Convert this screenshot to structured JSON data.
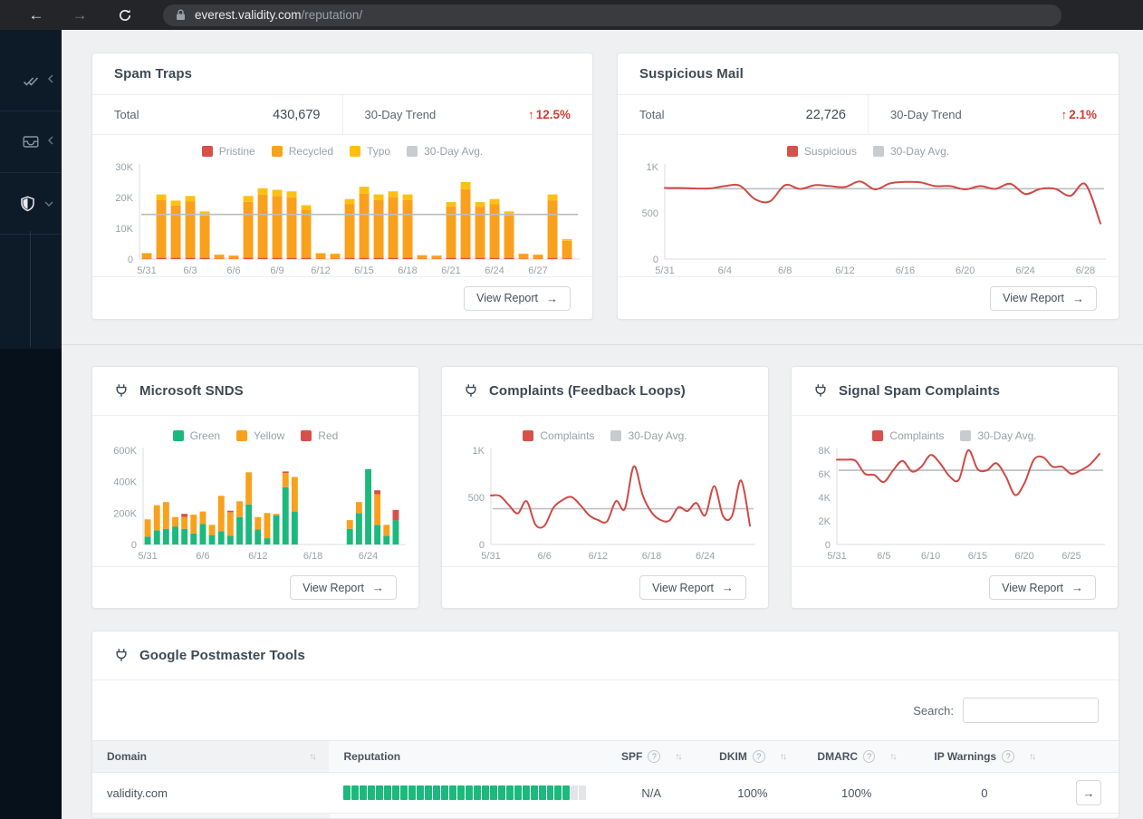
{
  "browser": {
    "url_host": "everest.validity.com",
    "url_path": "/reputation/"
  },
  "icons": {
    "arrow_up": "↑",
    "arrow_right": "→",
    "sort": "↑↓",
    "help": "?",
    "back": "←",
    "forward": "→"
  },
  "colors": {
    "red": "#d8504a",
    "orange": "#f9a11c",
    "yellow": "#fdc012",
    "green": "#1cb97d",
    "gray_avg": "#c9cccf",
    "trend_red": "#d63a32",
    "segment_empty": "#e3e5e7"
  },
  "cards": {
    "spam_traps": {
      "title": "Spam Traps",
      "total_label": "Total",
      "total_value": "430,679",
      "trend_label": "30-Day Trend",
      "trend_value": "12.5%",
      "view_report": "View Report"
    },
    "suspicious": {
      "title": "Suspicious Mail",
      "total_label": "Total",
      "total_value": "22,726",
      "trend_label": "30-Day Trend",
      "trend_value": "2.1%",
      "view_report": "View Report"
    },
    "snds": {
      "title": "Microsoft SNDS",
      "view_report": "View Report"
    },
    "complaints": {
      "title": "Complaints (Feedback Loops)",
      "view_report": "View Report"
    },
    "signal": {
      "title": "Signal Spam Complaints",
      "view_report": "View Report"
    },
    "postmaster": {
      "title": "Google Postmaster Tools",
      "search_label": "Search:"
    }
  },
  "charts": {
    "spam_traps": {
      "type": "stacked-bar",
      "ymax": 30000,
      "avg": 14500,
      "yticks": [
        {
          "v": 0,
          "label": "0"
        },
        {
          "v": 10000,
          "label": "10K"
        },
        {
          "v": 20000,
          "label": "20K"
        },
        {
          "v": 30000,
          "label": "30K"
        }
      ],
      "xticks": [
        {
          "i": 0,
          "label": "5/31"
        },
        {
          "i": 3,
          "label": "6/3"
        },
        {
          "i": 6,
          "label": "6/6"
        },
        {
          "i": 9,
          "label": "6/9"
        },
        {
          "i": 12,
          "label": "6/12"
        },
        {
          "i": 15,
          "label": "6/15"
        },
        {
          "i": 18,
          "label": "6/18"
        },
        {
          "i": 21,
          "label": "6/21"
        },
        {
          "i": 24,
          "label": "6/24"
        },
        {
          "i": 27,
          "label": "6/27"
        }
      ],
      "legend": [
        {
          "label": "Pristine",
          "color": "#d8504a"
        },
        {
          "label": "Recycled",
          "color": "#f9a11c"
        },
        {
          "label": "Typo",
          "color": "#fdc012"
        },
        {
          "label": "30-Day Avg.",
          "color": "#c9cccf"
        }
      ],
      "series": [
        {
          "name": "Pristine",
          "color": "#d8504a",
          "values": [
            120,
            400,
            400,
            400,
            400,
            120,
            120,
            400,
            400,
            400,
            400,
            400,
            120,
            120,
            400,
            400,
            400,
            400,
            400,
            120,
            120,
            400,
            400,
            400,
            400,
            400,
            120,
            120,
            400,
            250
          ]
        },
        {
          "name": "Recycled",
          "color": "#f9a11c",
          "values": [
            1730,
            18800,
            17000,
            18400,
            13800,
            1230,
            960,
            18200,
            20500,
            20100,
            19700,
            15600,
            1700,
            1520,
            17400,
            20900,
            18800,
            19600,
            18800,
            1050,
            960,
            16500,
            22300,
            16500,
            17400,
            13800,
            1520,
            1240,
            18700,
            5700
          ]
        },
        {
          "name": "Typo",
          "color": "#fdc012",
          "values": [
            150,
            1800,
            1600,
            1700,
            1300,
            150,
            120,
            1900,
            2100,
            2000,
            1900,
            1500,
            180,
            160,
            1700,
            2200,
            1800,
            2000,
            1800,
            130,
            120,
            1600,
            2300,
            1600,
            1700,
            1300,
            160,
            140,
            1900,
            550
          ]
        }
      ]
    },
    "suspicious": {
      "type": "line",
      "ymax": 1000,
      "avg": 762,
      "yticks": [
        {
          "v": 0,
          "label": "0"
        },
        {
          "v": 500,
          "label": "500"
        },
        {
          "v": 1000,
          "label": "1K"
        }
      ],
      "xticks": [
        {
          "i": 0,
          "label": "5/31"
        },
        {
          "i": 4,
          "label": "6/4"
        },
        {
          "i": 8,
          "label": "6/8"
        },
        {
          "i": 12,
          "label": "6/12"
        },
        {
          "i": 16,
          "label": "6/16"
        },
        {
          "i": 20,
          "label": "6/20"
        },
        {
          "i": 24,
          "label": "6/24"
        },
        {
          "i": 28,
          "label": "6/28"
        }
      ],
      "legend": [
        {
          "label": "Suspicious",
          "color": "#d8504a"
        },
        {
          "label": "30-Day Avg.",
          "color": "#c9cccf"
        }
      ],
      "series": [
        {
          "name": "Suspicious",
          "color": "#cf4a45",
          "values": [
            770,
            770,
            765,
            765,
            790,
            795,
            650,
            625,
            800,
            760,
            800,
            790,
            780,
            840,
            755,
            820,
            835,
            830,
            790,
            790,
            755,
            790,
            760,
            815,
            705,
            760,
            760,
            685,
            810,
            385
          ]
        }
      ]
    },
    "snds": {
      "type": "stacked-bar",
      "ymax": 600,
      "avg": null,
      "yticks": [
        {
          "v": 0,
          "label": "0"
        },
        {
          "v": 200,
          "label": "200K"
        },
        {
          "v": 400,
          "label": "400K"
        },
        {
          "v": 600,
          "label": "600K"
        }
      ],
      "xticks": [
        {
          "i": 0,
          "label": "5/31"
        },
        {
          "i": 6,
          "label": "6/6"
        },
        {
          "i": 12,
          "label": "6/12"
        },
        {
          "i": 18,
          "label": "6/18"
        },
        {
          "i": 24,
          "label": "6/24"
        }
      ],
      "legend": [
        {
          "label": "Green",
          "color": "#1cb97d"
        },
        {
          "label": "Yellow",
          "color": "#f9a11c"
        },
        {
          "label": "Red",
          "color": "#d8504a"
        }
      ],
      "series": [
        {
          "name": "Green",
          "color": "#1cb97d",
          "values": [
            50,
            90,
            100,
            115,
            100,
            70,
            130,
            60,
            85,
            55,
            175,
            255,
            95,
            40,
            185,
            365,
            210,
            0,
            0,
            0,
            0,
            0,
            100,
            200,
            480,
            125,
            55,
            155
          ]
        },
        {
          "name": "Yellow",
          "color": "#f9a11c",
          "values": [
            110,
            160,
            170,
            60,
            75,
            120,
            80,
            65,
            225,
            150,
            100,
            205,
            80,
            160,
            10,
            90,
            220,
            0,
            0,
            0,
            0,
            0,
            55,
            70,
            0,
            195,
            70,
            0
          ]
        },
        {
          "name": "Red",
          "color": "#d8504a",
          "values": [
            0,
            0,
            0,
            0,
            20,
            0,
            0,
            0,
            0,
            10,
            0,
            0,
            0,
            0,
            0,
            10,
            0,
            0,
            0,
            0,
            0,
            0,
            0,
            0,
            0,
            25,
            0,
            65
          ]
        }
      ]
    },
    "complaints": {
      "type": "line",
      "ymax": 1000,
      "avg": 380,
      "yticks": [
        {
          "v": 0,
          "label": "0"
        },
        {
          "v": 500,
          "label": "500"
        },
        {
          "v": 1000,
          "label": "1K"
        }
      ],
      "xticks": [
        {
          "i": 0,
          "label": "5/31"
        },
        {
          "i": 6,
          "label": "6/6"
        },
        {
          "i": 12,
          "label": "6/12"
        },
        {
          "i": 18,
          "label": "6/18"
        },
        {
          "i": 24,
          "label": "6/24"
        }
      ],
      "legend": [
        {
          "label": "Complaints",
          "color": "#d8504a"
        },
        {
          "label": "30-Day Avg.",
          "color": "#c9cccf"
        }
      ],
      "series": [
        {
          "name": "Complaints",
          "color": "#cf4a45",
          "values": [
            520,
            515,
            420,
            330,
            460,
            210,
            200,
            390,
            470,
            505,
            420,
            310,
            260,
            245,
            460,
            380,
            830,
            520,
            340,
            260,
            255,
            395,
            355,
            440,
            310,
            620,
            300,
            305,
            680,
            200
          ]
        }
      ]
    },
    "signal": {
      "type": "line",
      "ymax": 8000,
      "avg": 6300,
      "yticks": [
        {
          "v": 0,
          "label": "0"
        },
        {
          "v": 2000,
          "label": "2K"
        },
        {
          "v": 4000,
          "label": "4K"
        },
        {
          "v": 6000,
          "label": "6K"
        },
        {
          "v": 8000,
          "label": "8K"
        }
      ],
      "xticks": [
        {
          "i": 0,
          "label": "5/31"
        },
        {
          "i": 5,
          "label": "6/5"
        },
        {
          "i": 10,
          "label": "6/10"
        },
        {
          "i": 15,
          "label": "6/15"
        },
        {
          "i": 20,
          "label": "6/20"
        },
        {
          "i": 25,
          "label": "6/25"
        }
      ],
      "legend": [
        {
          "label": "Complaints",
          "color": "#d8504a"
        },
        {
          "label": "30-Day Avg.",
          "color": "#c9cccf"
        }
      ],
      "series": [
        {
          "name": "Complaints",
          "color": "#cf4a45",
          "values": [
            7200,
            7200,
            7100,
            6000,
            5900,
            5300,
            6300,
            7100,
            6200,
            6600,
            7600,
            6900,
            5800,
            5500,
            8000,
            6400,
            6300,
            6900,
            5800,
            4200,
            5200,
            7200,
            7400,
            6600,
            6600,
            6000,
            6300,
            6800,
            7700
          ]
        }
      ]
    }
  },
  "table": {
    "headers": {
      "domain": "Domain",
      "reputation": "Reputation",
      "spf": "SPF",
      "dkim": "DKIM",
      "dmarc": "DMARC",
      "ip_warnings": "IP Warnings"
    },
    "rows": [
      {
        "domain": "validity.com",
        "reputation_segments": 30,
        "reputation_filled": 28,
        "spf": "N/A",
        "dkim": "100%",
        "dmarc": "100%",
        "ip_warnings": "0"
      }
    ]
  }
}
